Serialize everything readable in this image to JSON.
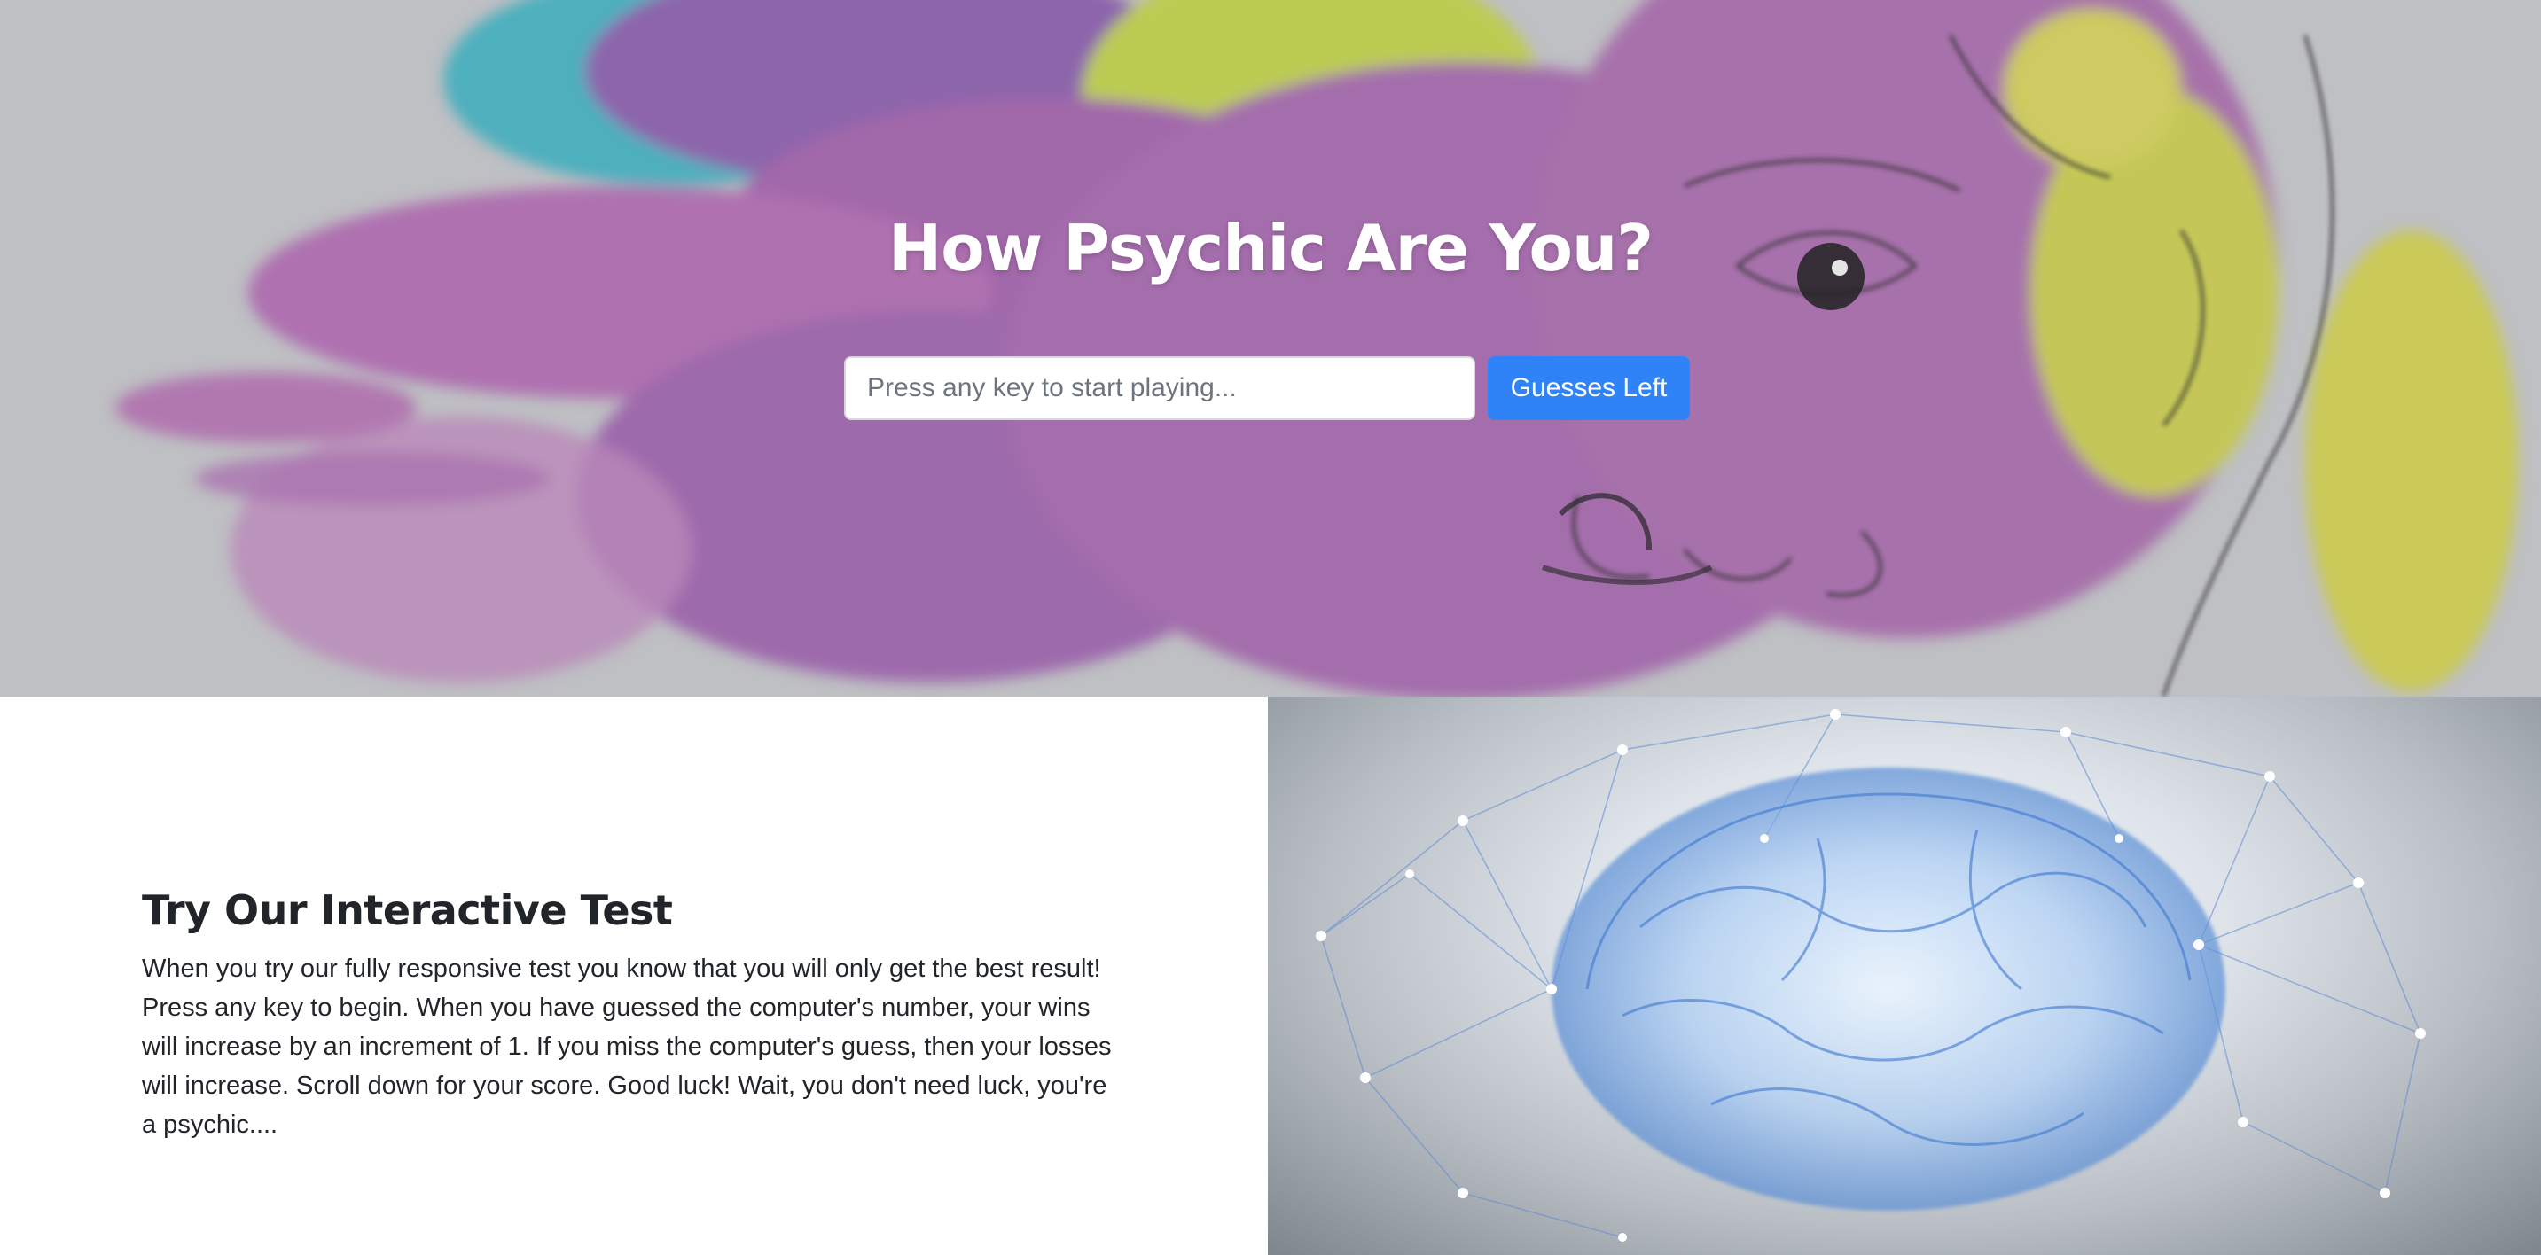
{
  "hero": {
    "title": "How Psychic Are You?",
    "input_placeholder": "Press any key to start playing...",
    "button_label": "Guesses Left",
    "accent_color": "#2f83f6"
  },
  "intro": {
    "heading": "Try Our Interactive Test",
    "body": "When you try our fully responsive test you know that you will only get the best result! Press any key to begin. When you have guessed the computer's number, your wins will increase by an increment of 1. If you miss the computer's guess, then your losses will increase. Scroll down for your score. Good luck! Wait, you don't need luck, you're a psychic...."
  },
  "images": {
    "hero_art": "watercolor-face-illustration",
    "side_art": "glowing-brain-network"
  }
}
